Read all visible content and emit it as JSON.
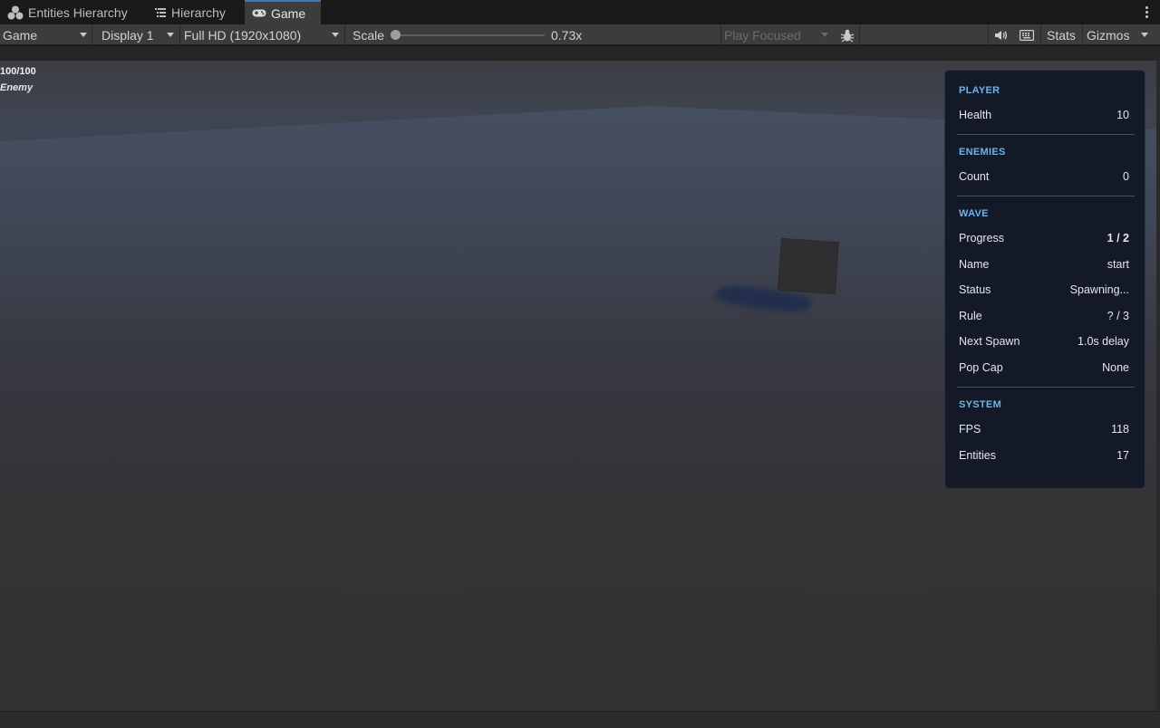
{
  "tabs": [
    {
      "label": "Entities Hierarchy",
      "icon": "entities-icon"
    },
    {
      "label": "Hierarchy",
      "icon": "hierarchy-list-icon"
    },
    {
      "label": "Game",
      "icon": "gamepad-icon",
      "active": true
    }
  ],
  "toolbar": {
    "view_mode": "Game",
    "display": "Display 1",
    "resolution": "Full HD (1920x1080)",
    "scale_label": "Scale",
    "scale_value": "0.73x",
    "play_mode": "Play Focused",
    "stats_label": "Stats",
    "gizmos_label": "Gizmos"
  },
  "viewport": {
    "health_text": "100/100",
    "entity_label": "Enemy"
  },
  "panel": {
    "player": {
      "title": "PLAYER",
      "rows": [
        {
          "label": "Health",
          "value": "10"
        }
      ]
    },
    "enemies": {
      "title": "ENEMIES",
      "rows": [
        {
          "label": "Count",
          "value": "0"
        }
      ]
    },
    "wave": {
      "title": "WAVE",
      "rows": [
        {
          "label": "Progress",
          "value": "1 / 2"
        },
        {
          "label": "Name",
          "value": "start"
        },
        {
          "label": "Status",
          "value": "Spawning..."
        },
        {
          "label": "Rule",
          "value": "? / 3"
        },
        {
          "label": "Next Spawn",
          "value": "1.0s delay"
        },
        {
          "label": "Pop Cap",
          "value": "None"
        }
      ]
    },
    "system": {
      "title": "SYSTEM",
      "rows": [
        {
          "label": "FPS",
          "value": "118"
        },
        {
          "label": "Entities",
          "value": "17"
        }
      ]
    }
  },
  "colors": {
    "accent_header": "#6fb3ea",
    "active_tab_border": "#3a79bb",
    "panel_bg": "#131926"
  }
}
